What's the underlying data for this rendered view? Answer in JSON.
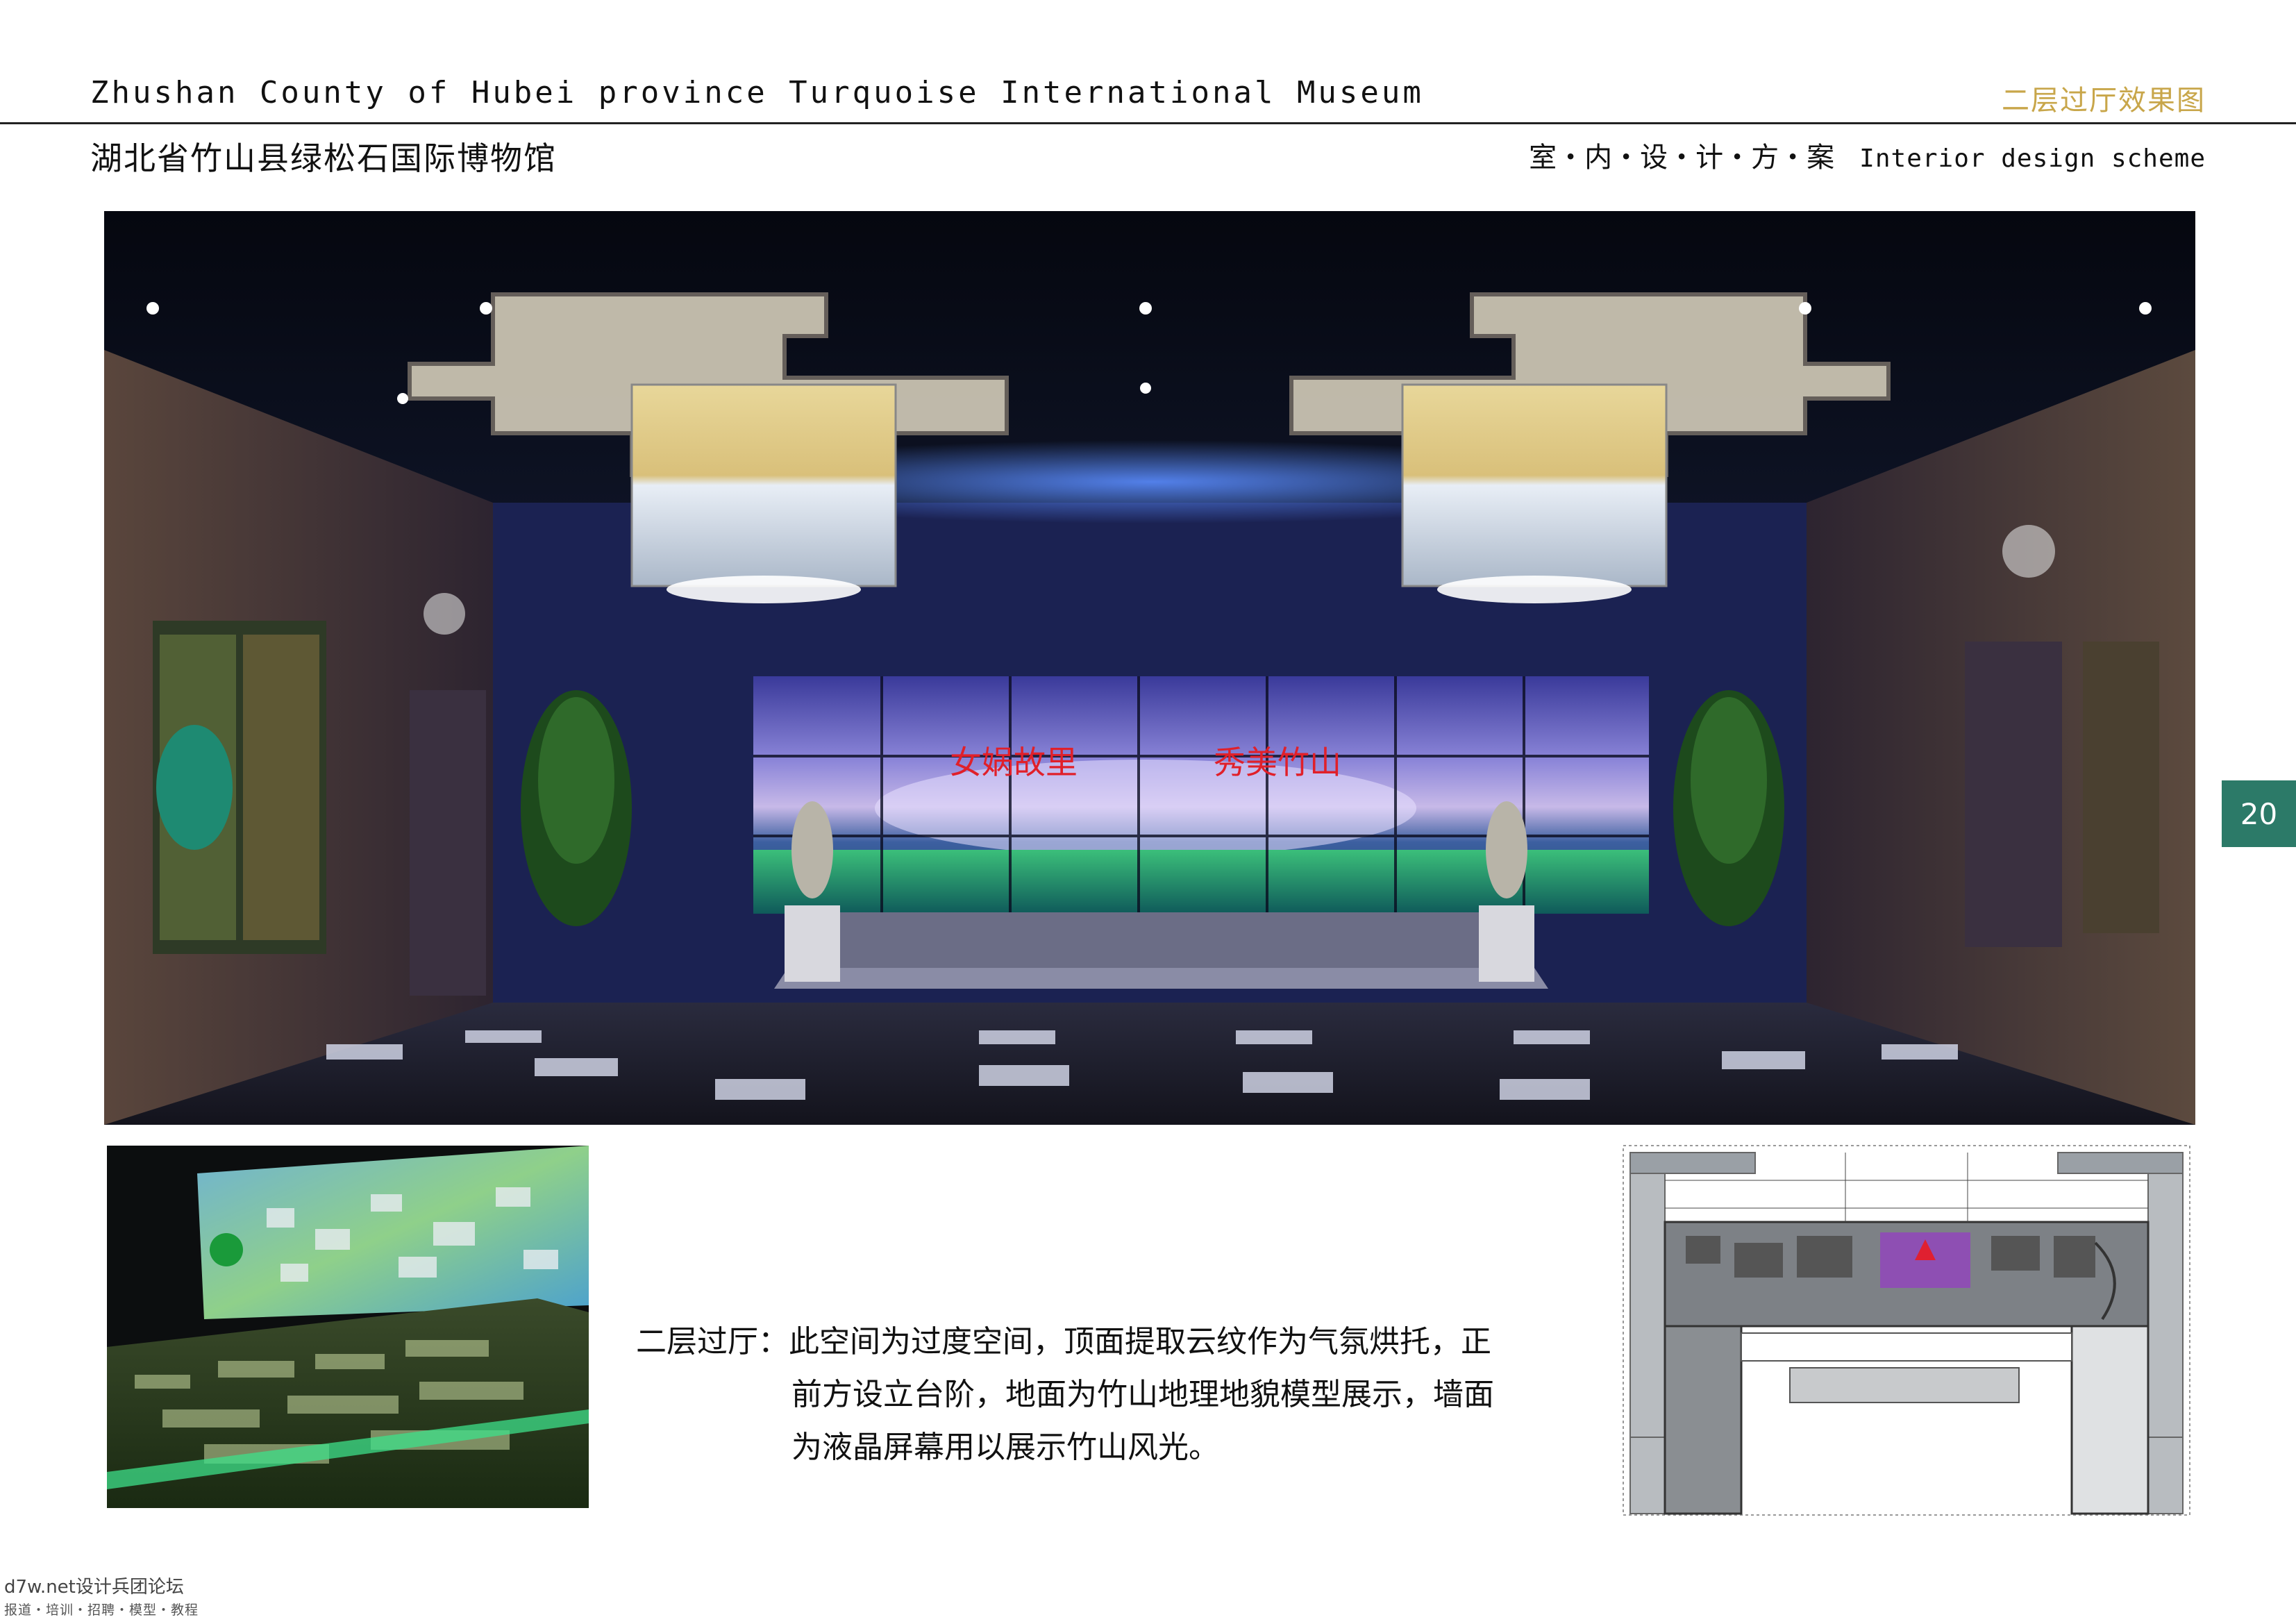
{
  "header": {
    "title_en": "Zhushan County of Hubei province Turquoise International Museum",
    "title_cn": "湖北省竹山县绿松石国际博物馆",
    "page_title": "二层过厅效果图",
    "subtitle_cn": "室・内・设・计・方・案",
    "subtitle_en": "Interior design scheme"
  },
  "page_number": "20",
  "main_render": {
    "screen_text_left": "女娲故里",
    "screen_text_right": "秀美竹山"
  },
  "description": {
    "label": "二层过厅：",
    "lines": [
      "此空间为过度空间，顶面提取云纹作为气氛烘托，正",
      "前方设立台阶，地面为竹山地理地貌模型展示，墙面",
      "为液晶屏幕用以展示竹山风光。"
    ]
  },
  "watermark": {
    "main": "d7w.net设计兵团论坛",
    "sub": "报道・培训・招聘・模型・教程"
  },
  "colors": {
    "accent_gold": "#c8a64a",
    "tab_green": "#2c7a68",
    "screen_text_red": "#e0202a"
  }
}
